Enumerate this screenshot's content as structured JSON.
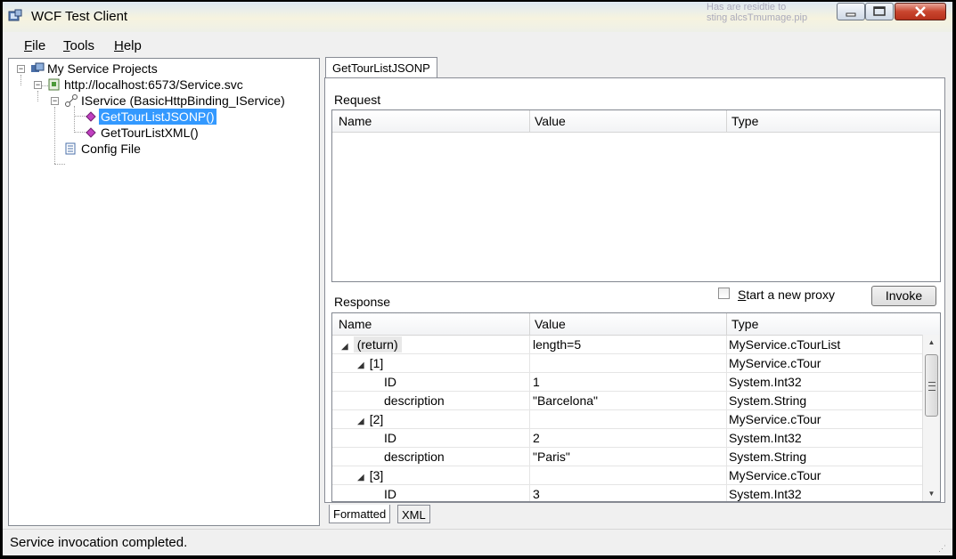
{
  "window": {
    "title": "WCF Test Client"
  },
  "background_text": [
    "Has are residtie to",
    "sting alcsTmumage.pip"
  ],
  "menu": [
    {
      "label": "File",
      "accel": "F",
      "rest": "ile"
    },
    {
      "label": "Tools",
      "accel": "T",
      "rest": "ools"
    },
    {
      "label": "Help",
      "accel": "H",
      "rest": "elp"
    }
  ],
  "tree": {
    "root": "My Service Projects",
    "endpoint": "http://localhost:6573/Service.svc",
    "contract": "IService (BasicHttpBinding_IService)",
    "op1": "GetTourListJSONP()",
    "op2": "GetTourListXML()",
    "config": "Config File",
    "icons": {
      "root": "projects-icon",
      "endpoint": "service-icon",
      "contract": "contract-icon",
      "op": "operation-icon",
      "config": "config-file-icon"
    }
  },
  "tab": {
    "label": "GetTourListJSONP"
  },
  "request": {
    "label": "Request",
    "columns": [
      "Name",
      "Value",
      "Type"
    ]
  },
  "response": {
    "label": "Response",
    "columns": [
      "Name",
      "Value",
      "Type"
    ],
    "rows": [
      {
        "name": "(return)",
        "value": "length=5",
        "type": "MyService.cTourList",
        "level": 0,
        "expand": true
      },
      {
        "name": "[1]",
        "value": "",
        "type": "MyService.cTour",
        "level": 1,
        "expand": true
      },
      {
        "name": "ID",
        "value": "1",
        "type": "System.Int32",
        "level": 2,
        "expand": false
      },
      {
        "name": "description",
        "value": "\"Barcelona\"",
        "type": "System.String",
        "level": 2,
        "expand": false
      },
      {
        "name": "[2]",
        "value": "",
        "type": "MyService.cTour",
        "level": 1,
        "expand": true
      },
      {
        "name": "ID",
        "value": "2",
        "type": "System.Int32",
        "level": 2,
        "expand": false
      },
      {
        "name": "description",
        "value": "\"Paris\"",
        "type": "System.String",
        "level": 2,
        "expand": false
      },
      {
        "name": "[3]",
        "value": "",
        "type": "MyService.cTour",
        "level": 1,
        "expand": true
      },
      {
        "name": "ID",
        "value": "3",
        "type": "System.Int32",
        "level": 2,
        "expand": false
      }
    ]
  },
  "new_proxy": {
    "label": "Start a new proxy",
    "accel": "S",
    "rest": "tart a new proxy",
    "checked": false
  },
  "invoke": {
    "label": "Invoke"
  },
  "bottom_tabs": {
    "formatted": "Formatted",
    "xml": "XML"
  },
  "status": {
    "text": "Service invocation completed."
  }
}
